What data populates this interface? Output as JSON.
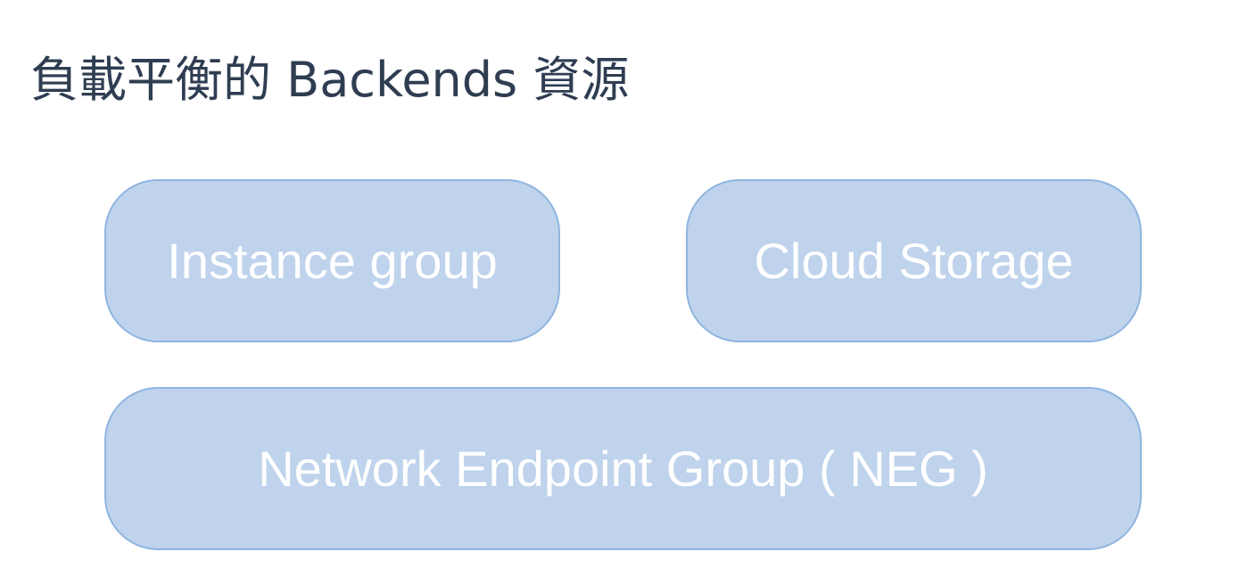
{
  "title": "負載平衡的 Backends 資源",
  "boxes": {
    "instance_group": "Instance group",
    "cloud_storage": "Cloud Storage",
    "neg": "Network Endpoint Group ( NEG )"
  },
  "colors": {
    "title_text": "#2f3d52",
    "box_fill": "#bfd3ec",
    "box_border": "#8fb5e0",
    "box_text": "#ffffff"
  }
}
